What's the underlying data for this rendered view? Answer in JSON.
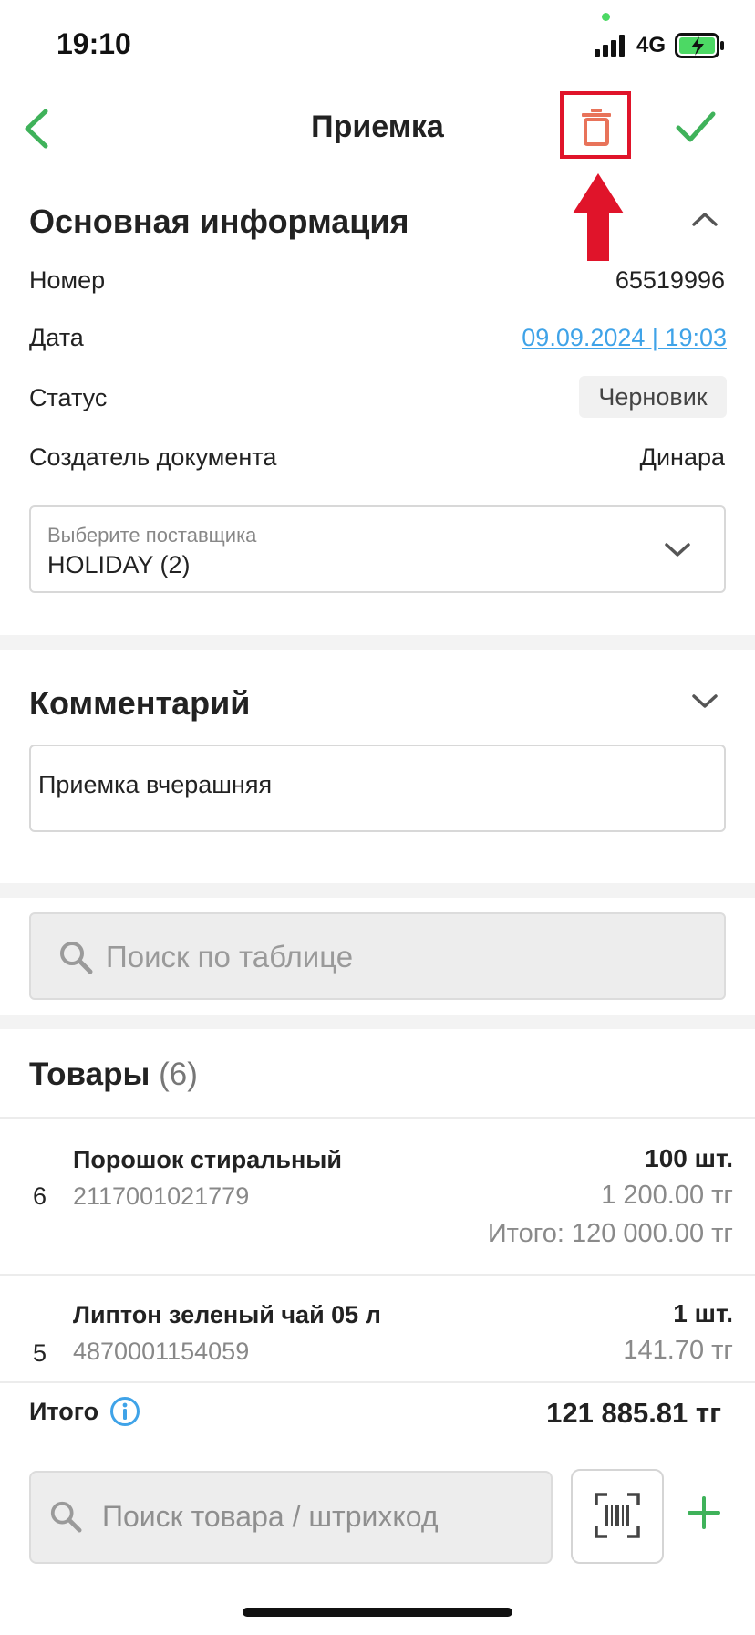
{
  "status_bar": {
    "time": "19:10",
    "network": "4G"
  },
  "header": {
    "title": "Приемка"
  },
  "main_info": {
    "title": "Основная информация",
    "number_label": "Номер",
    "number_value": "65519996",
    "date_label": "Дата",
    "date_value": "09.09.2024 | 19:03",
    "status_label": "Статус",
    "status_value": "Черновик",
    "creator_label": "Создатель документа",
    "creator_value": "Динара",
    "supplier_placeholder": "Выберите поставщика",
    "supplier_value": "HOLIDAY (2)"
  },
  "comment": {
    "title": "Комментарий",
    "text": "Приемка вчерашняя"
  },
  "table_search": {
    "placeholder": "Поиск по таблице"
  },
  "goods": {
    "title": "Товары",
    "count": "(6)",
    "items": [
      {
        "index": "6",
        "name": "Порошок стиральный",
        "barcode": "2117001021779",
        "qty": "100 шт.",
        "price": "1 200.00 тг",
        "total": "Итого: 120 000.00 тг"
      },
      {
        "index": "5",
        "name": "Липтон зеленый чай 05 л",
        "barcode": "4870001154059",
        "qty": "1 шт.",
        "price": "141.70 тг"
      }
    ]
  },
  "footer": {
    "total_label": "Итого",
    "total_value": "121 885.81 тг",
    "search_placeholder": "Поиск товара / штрихкод"
  },
  "colors": {
    "accent_green": "#3fb25a",
    "link_blue": "#3fa3e8",
    "highlight_red": "#e0142a",
    "trash_orange": "#e8735a"
  }
}
